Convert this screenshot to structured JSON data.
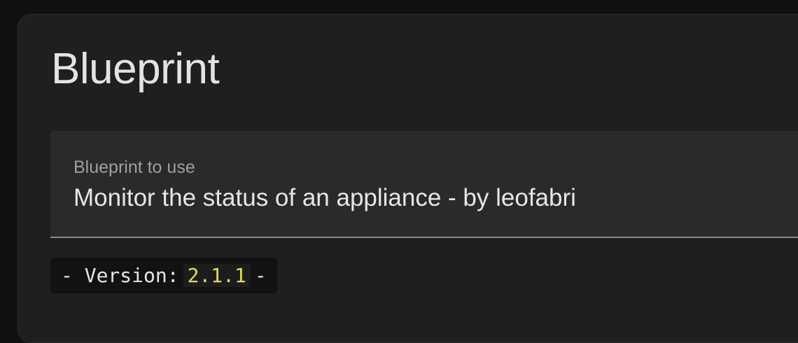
{
  "card": {
    "title": "Blueprint"
  },
  "blueprint_select": {
    "label": "Blueprint to use",
    "value": "Monitor the status of an appliance - by leofabri"
  },
  "version_note": {
    "prefix": "- Version:",
    "number": "2.1.1",
    "suffix": "-"
  },
  "colors": {
    "page_background": "#111111",
    "card_background": "#1f1f1f",
    "field_background": "#2a2a2a",
    "version_highlight": "#e5e03a"
  }
}
